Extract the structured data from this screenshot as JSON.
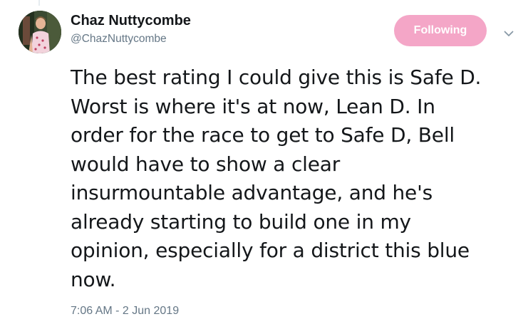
{
  "author": {
    "display_name": "Chaz Nuttycombe",
    "handle": "@ChazNuttycombe"
  },
  "follow_button": {
    "label": "Following",
    "color": "#f4a6c7"
  },
  "caret_icon": "chevron-down-icon",
  "tweet": {
    "lines": [
      "The best rating I could give this is Safe D.",
      "Worst is where it's at now, Lean D. In",
      "order for the race to get to Safe D, Bell",
      "would have to show a clear",
      "insurmountable advantage, and he's",
      "already starting to build one in my",
      "opinion, especially for a district this blue",
      "now."
    ],
    "timestamp": "7:06 AM - 2 Jun 2019"
  },
  "colors": {
    "text": "#14171a",
    "secondary_text": "#657786"
  }
}
